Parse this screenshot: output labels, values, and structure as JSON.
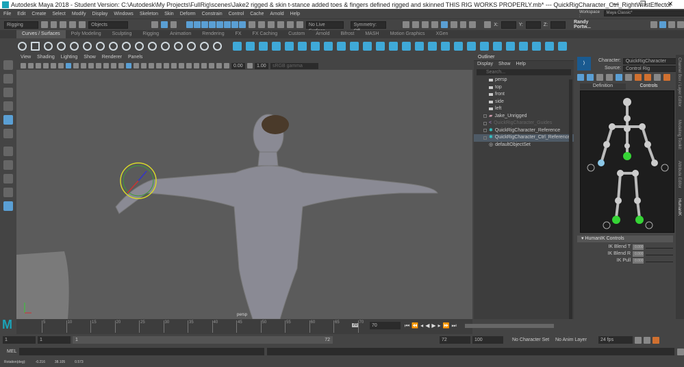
{
  "title": {
    "text": "Autodesk Maya 2018 - Student Version: C:\\Autodesk\\My Projects\\FullRig\\scenes\\Jake2 rigged & skin t-stance added toes & fingers defined rigged and skinned THIS RIG WORKS PROPERLY.mb*  ---  QuickRigCharacter_Ctrl_RightWristEffector",
    "minimize": "—",
    "maximize": "❐",
    "close": "✕",
    "logo": "M"
  },
  "menu": [
    "File",
    "Edit",
    "Create",
    "Select",
    "Modify",
    "Display",
    "Windows",
    "Skeleton",
    "Skin",
    "Deform",
    "Constrain",
    "Control",
    "Cache",
    "Arnold",
    "Help"
  ],
  "status": {
    "menuset": "Rigging",
    "objects": "Objects",
    "live": "No Live Surface",
    "symmetry": "Symmetry: Off",
    "x": "X:",
    "y": "Y:",
    "z": "Z:",
    "user": "Randy Portw...",
    "workspace_label": "Workspace :",
    "workspace": "Maya Classic*"
  },
  "shelf_tabs": [
    "Curves / Surfaces",
    "Poly Modeling",
    "Sculpting",
    "Rigging",
    "Animation",
    "Rendering",
    "FX",
    "FX Caching",
    "Custom",
    "Arnold",
    "Bifrost",
    "MASH",
    "Motion Graphics",
    "XGen"
  ],
  "viewport": {
    "menu": [
      "View",
      "Shading",
      "Lighting",
      "Show",
      "Renderer",
      "Panels"
    ],
    "exposure": "0.00",
    "gamma": "1.00",
    "colorspace": "sRGB gamma",
    "camera_label": "persp"
  },
  "outliner": {
    "title": "Outliner",
    "menu": [
      "Display",
      "Show",
      "Help"
    ],
    "search": "Search...",
    "items": [
      {
        "label": "persp",
        "type": "camera"
      },
      {
        "label": "top",
        "type": "camera"
      },
      {
        "label": "front",
        "type": "camera"
      },
      {
        "label": "side",
        "type": "camera"
      },
      {
        "label": "left",
        "type": "camera"
      },
      {
        "label": "Jake_Unrigged",
        "type": "mesh"
      },
      {
        "label": "QuickRigCharacter_Guides",
        "type": "guides"
      },
      {
        "label": "QuickRigCharacter_Reference",
        "type": "skeleton"
      },
      {
        "label": "QuickRigCharacter_Ctrl_Reference",
        "type": "skeleton",
        "selected": true
      },
      {
        "label": "defaultObjectSet",
        "type": "set"
      }
    ]
  },
  "hik": {
    "character_label": "Character:",
    "character": "QuickRigCharacter",
    "source_label": "Source:",
    "source": "Control Rig",
    "tabs": [
      "Definition",
      "Controls"
    ],
    "section": "HumanIK Controls",
    "params": [
      {
        "label": "IK Blend T",
        "value": "0.000"
      },
      {
        "label": "IK Blend R",
        "value": "0.000"
      },
      {
        "label": "IK Pull",
        "value": "0.000"
      }
    ]
  },
  "side_tabs": [
    "Channel Box / Layer Editor",
    "Modeling Toolkit",
    "Attribute Editor",
    "HumanIK"
  ],
  "timeline": {
    "ticks": [
      "5",
      "10",
      "15",
      "20",
      "25",
      "30",
      "35",
      "40",
      "45",
      "50",
      "55",
      "60",
      "65",
      "70"
    ],
    "current": "70",
    "current_field": "70"
  },
  "range": {
    "start": "1",
    "anim_start": "1",
    "slider_start": "1",
    "slider_end": "72",
    "end": "72",
    "anim_end": "100",
    "char_set": "No Character Set",
    "anim_layer": "No Anim Layer",
    "fps": "24 fps"
  },
  "cmd": {
    "label": "MEL"
  },
  "help": {
    "label": "Rotation(deg):",
    "values": [
      "-0.216",
      "38.105",
      "0.573"
    ]
  },
  "colors": {
    "accent": "#5a9fd4",
    "viewport": "#5b5b5b",
    "ik_green": "#35d435"
  }
}
